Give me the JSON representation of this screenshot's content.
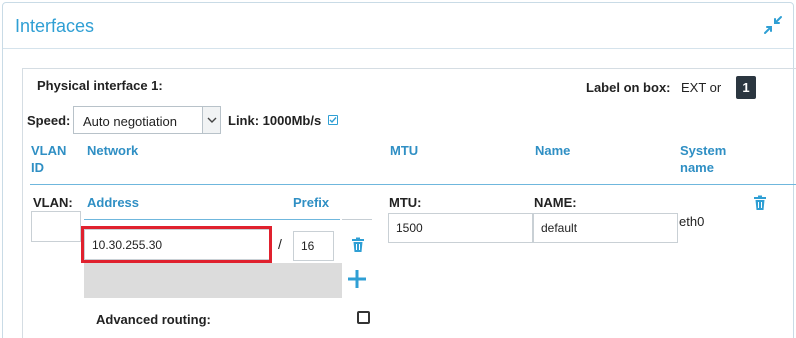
{
  "panel": {
    "title": "Interfaces"
  },
  "physical": {
    "title": "Physical interface 1:",
    "label_on_box_label": "Label on box:",
    "label_on_box_value": "EXT or",
    "label_badge": "1",
    "speed_label": "Speed:",
    "speed_value": "Auto negotiation",
    "link_label": "Link: 1000Mb/s"
  },
  "columns": {
    "vlan_id_1": "VLAN",
    "vlan_id_2": "ID",
    "network": "Network",
    "mtu": "MTU",
    "name": "Name",
    "system_name_1": "System",
    "system_name_2": "name"
  },
  "row": {
    "vlan_label": "VLAN:",
    "vlan_value": "",
    "address_label": "Address",
    "prefix_label": "Prefix",
    "address_value": "10.30.255.30",
    "slash": "/",
    "prefix_value": "16",
    "mtu_label": "MTU:",
    "mtu_value": "1500",
    "name_label": "NAME:",
    "name_value": "default",
    "system_name": "eth0",
    "advanced_routing_label": "Advanced routing:"
  },
  "colors": {
    "accent": "#2f9fd4",
    "highlight": "#e0212e"
  },
  "icons": {
    "collapse": "collapse-arrows-icon",
    "trash": "trash-icon",
    "plus": "plus-icon",
    "check": "checkbox-checked-icon"
  }
}
